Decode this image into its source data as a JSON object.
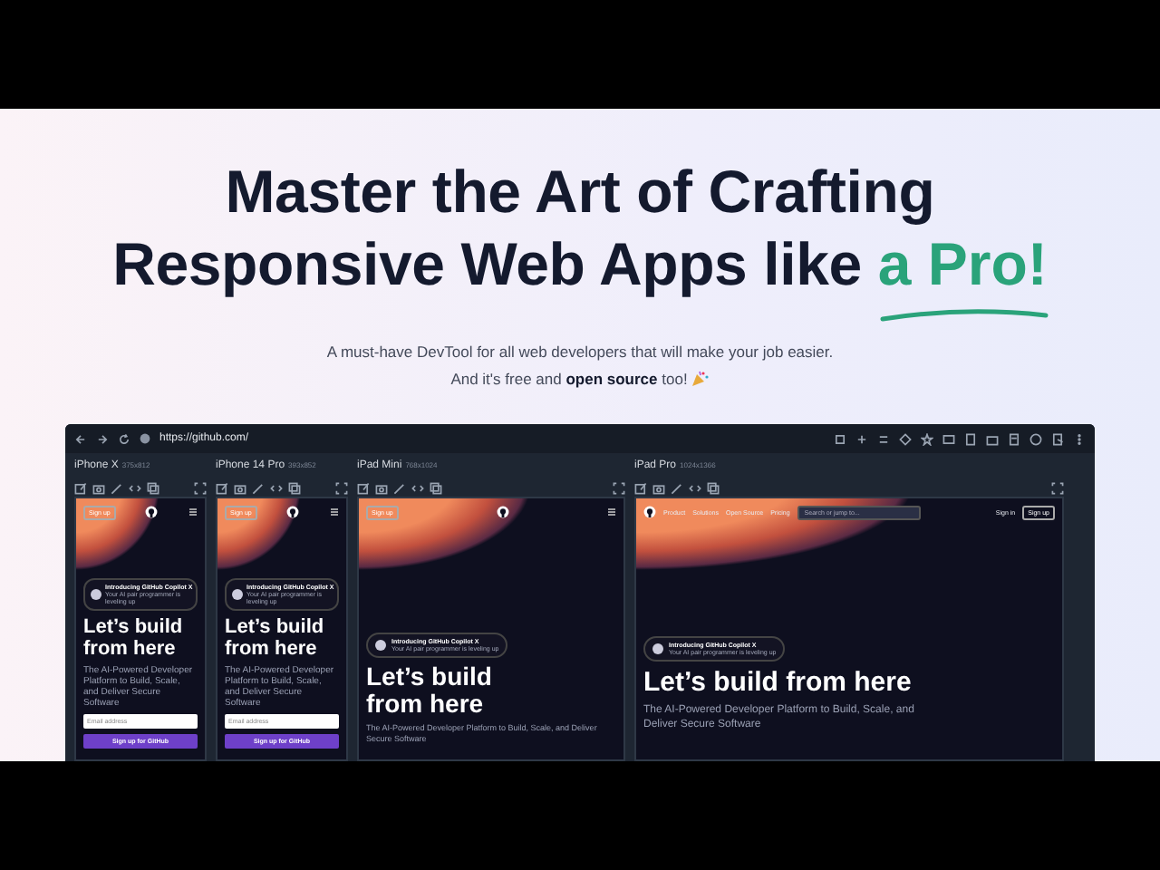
{
  "hero": {
    "title_lines": [
      "Master the Art of Crafting",
      "Responsive Web Apps like"
    ],
    "title_highlight": "a Pro!",
    "subtitle_lines": [
      "A must-have DevTool for all web developers that will make your job easier.",
      "And it's free and **open source** too!"
    ]
  },
  "browser": {
    "url": "https://github.com/"
  },
  "devices": [
    {
      "name": "iPhone X",
      "size": "375x812",
      "kind": "phone",
      "sign_button": "Sign up",
      "banner_title": "Introducing GitHub Copilot X",
      "banner_text": "Your AI pair programmer is leveling up",
      "headline": "Let’s build from here",
      "description": "The AI-Powered Developer Platform to Build, Scale, and Deliver Secure Software",
      "email_placeholder": "Email address",
      "cta": "Sign up for GitHub"
    },
    {
      "name": "iPhone 14 Pro",
      "size": "393x852",
      "kind": "phone",
      "sign_button": "Sign up",
      "banner_title": "Introducing GitHub Copilot X",
      "banner_text": "Your AI pair programmer is leveling up",
      "headline": "Let’s build from here",
      "description": "The AI-Powered Developer Platform to Build, Scale, and Deliver Secure Software",
      "email_placeholder": "Email address",
      "cta": "Sign up for GitHub"
    },
    {
      "name": "iPad Mini",
      "size": "768x1024",
      "kind": "tablet",
      "sign_button": "Sign up",
      "banner_title": "Introducing GitHub Copilot X",
      "banner_text": "Your AI pair programmer is leveling up",
      "headline": "Let’s build from here",
      "description": "The AI-Powered Developer Platform to Build, Scale, and Deliver Secure Software"
    },
    {
      "name": "iPad Pro",
      "size": "1024x1366",
      "kind": "desktop",
      "nav_links": [
        "Product",
        "Solutions",
        "Open Source",
        "Pricing"
      ],
      "search_placeholder": "Search or jump to...",
      "sign_in": "Sign in",
      "sign_button": "Sign up",
      "banner_title": "Introducing GitHub Copilot X",
      "banner_text": "Your AI pair programmer is leveling up",
      "headline": "Let’s build from here",
      "description": "The AI-Powered Developer Platform to Build, Scale, and Deliver Secure Software"
    }
  ]
}
